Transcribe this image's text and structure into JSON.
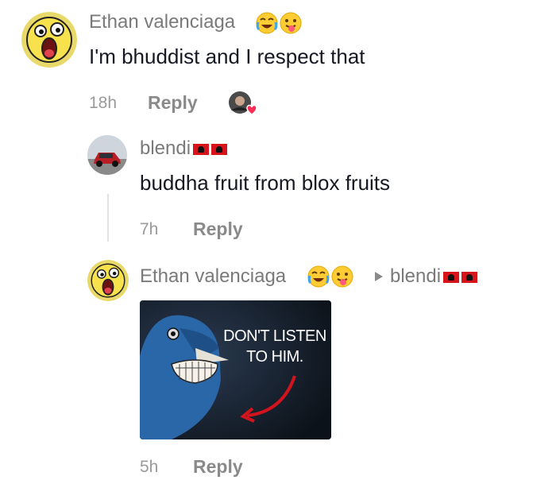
{
  "comments": [
    {
      "username": "Ethan valenciaga",
      "text": "I'm bhuddist and I respect that",
      "time": "18h",
      "reply_label": "Reply"
    },
    {
      "username": "blendi",
      "text": "buddha fruit from blox fruits",
      "time": "7h",
      "reply_label": "Reply"
    },
    {
      "username": "Ethan valenciaga",
      "reply_to": "blendi",
      "time": "5h",
      "reply_label": "Reply",
      "meme_text_line1": "DON'T LISTEN",
      "meme_text_line2": "TO HIM."
    }
  ],
  "icons": {
    "laugh": "face-with-tears-of-joy-icon",
    "tongue": "face-with-tongue-icon",
    "liked_by_creator": "creator-heart-avatar-icon",
    "reply_arrow": "reply-arrow-icon",
    "flag": "albania-flag-icon"
  },
  "colors": {
    "username": "#7a7a7a",
    "text": "#161823",
    "meta": "#9a9a9a",
    "flag": "#d7141a",
    "heart": "#fe2c55"
  }
}
